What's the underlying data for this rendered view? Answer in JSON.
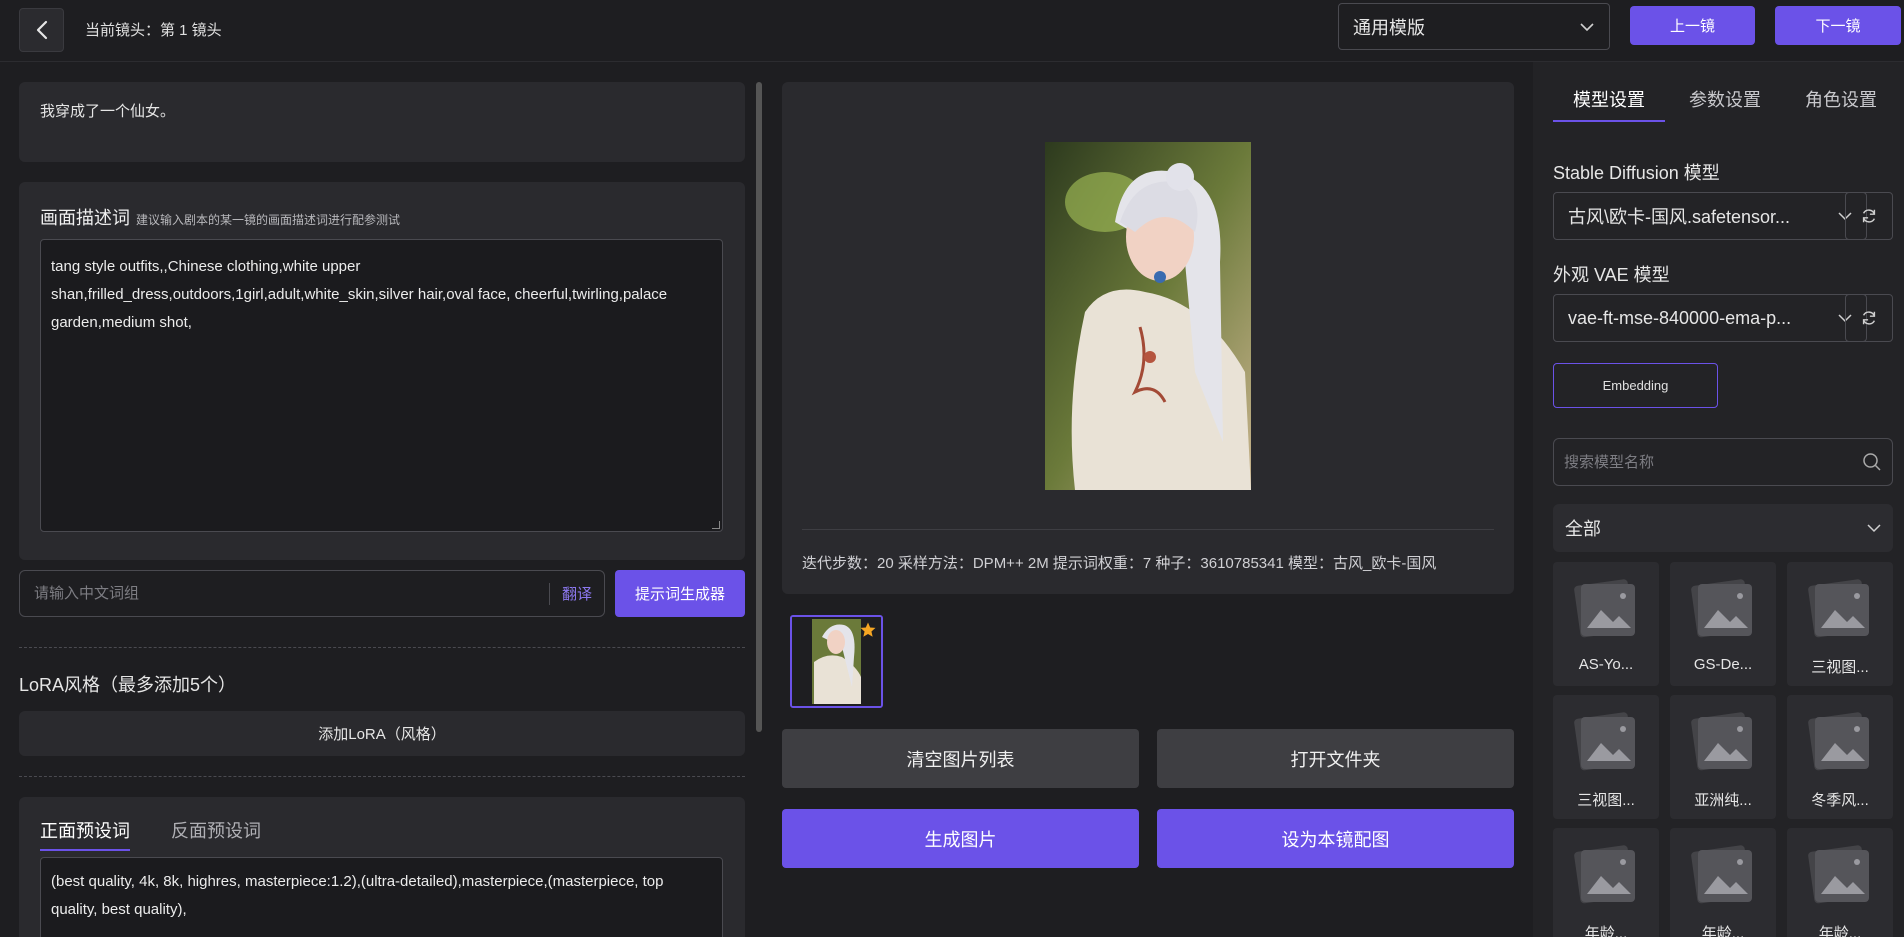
{
  "header": {
    "shot_title": "当前镜头：第 1 镜头",
    "template_value": "通用模版",
    "prev_label": "上一镜",
    "next_label": "下一镜"
  },
  "left": {
    "story_text": "我穿成了一个仙女。",
    "desc_title": "画面描述词",
    "desc_hint": "建议输入剧本的某一镜的画面描述词进行配参测试",
    "desc_text": "tang style outfits,,Chinese clothing,white upper shan,frilled_dress,outdoors,1girl,adult,white_skin,silver hair,oval face, cheerful,twirling,palace garden,medium shot,",
    "cn_placeholder": "请输入中文词组",
    "translate_label": "翻译",
    "prompt_gen_label": "提示词生成器",
    "lora_title": "LoRA风格（最多添加5个）",
    "lora_add_label": "添加LoRA（风格）",
    "preset_tab_positive": "正面预设词",
    "preset_tab_negative": "反面预设词",
    "preset_text": "(best quality, 4k, 8k, highres, masterpiece:1.2),(ultra-detailed),masterpiece,(masterpiece, top quality, best quality),"
  },
  "middle": {
    "meta_text": "迭代步数：20   采样方法：DPM++ 2M   提示词权重：7   种子：3610785341   模型：古风_欧卡-国风",
    "clear_label": "清空图片列表",
    "open_label": "打开文件夹",
    "generate_label": "生成图片",
    "set_label": "设为本镜配图"
  },
  "right": {
    "tabs": [
      "模型设置",
      "参数设置",
      "角色设置"
    ],
    "sd_label": "Stable Diffusion 模型",
    "sd_value": "古风\\欧卡-国风.safetensor...",
    "vae_label": "外观 VAE 模型",
    "vae_value": "vae-ft-mse-840000-ema-p...",
    "embedding_label": "Embedding",
    "search_placeholder": "搜索模型名称",
    "filter_value": "全部",
    "models": [
      "AS-Yo...",
      "GS-De...",
      "三视图...",
      "三视图...",
      "亚洲纯...",
      "冬季风...",
      "年龄...",
      "年龄...",
      "年龄..."
    ]
  },
  "colors": {
    "accent": "#6b52e8",
    "background": "#1e1e21",
    "card": "#2a2a2e"
  }
}
